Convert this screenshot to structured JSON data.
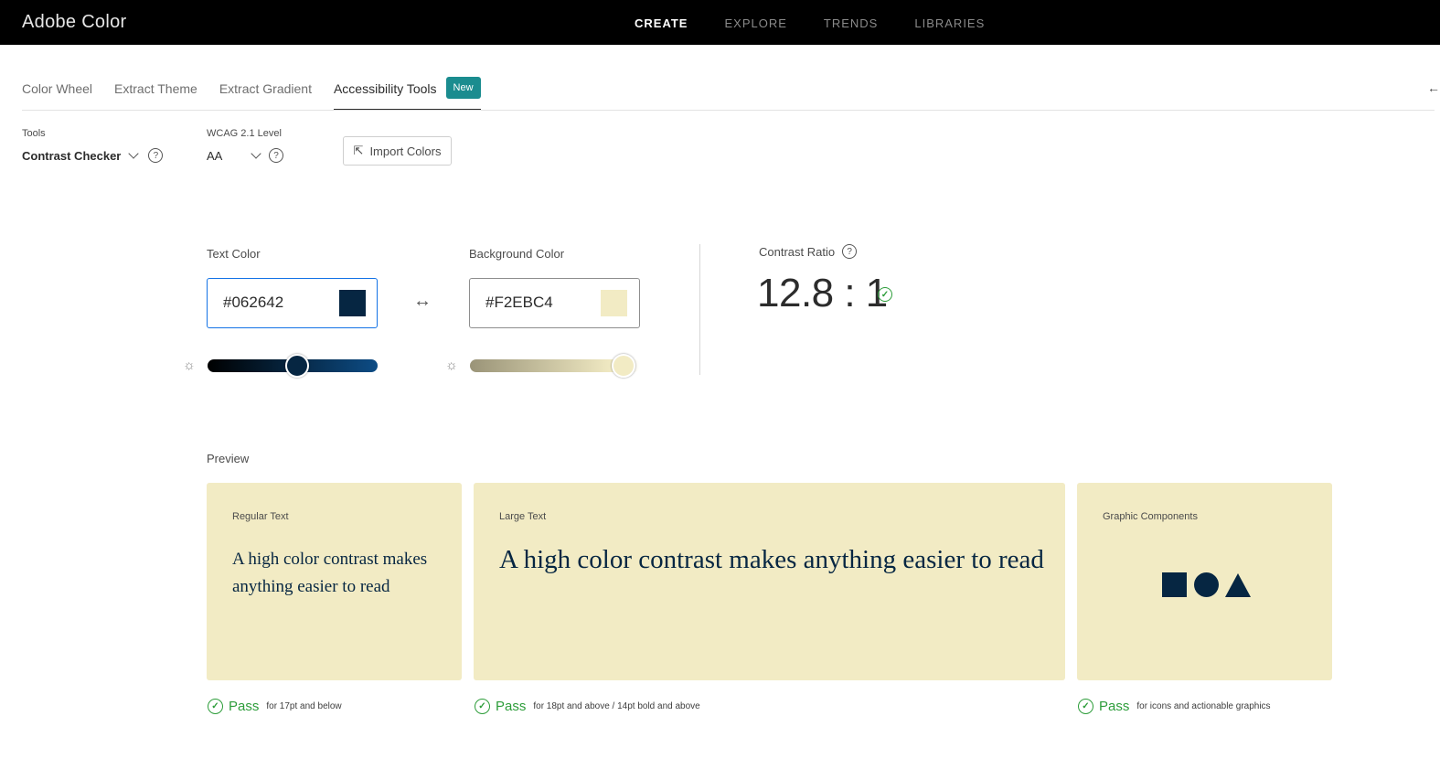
{
  "header": {
    "brand": "Adobe Color",
    "nav": [
      {
        "label": "CREATE",
        "active": true
      },
      {
        "label": "EXPLORE",
        "active": false
      },
      {
        "label": "TRENDS",
        "active": false
      },
      {
        "label": "LIBRARIES",
        "active": false
      }
    ]
  },
  "tabs": [
    {
      "label": "Color Wheel",
      "active": false
    },
    {
      "label": "Extract Theme",
      "active": false
    },
    {
      "label": "Extract Gradient",
      "active": false
    },
    {
      "label": "Accessibility Tools",
      "active": true,
      "badge": "New"
    }
  ],
  "controls": {
    "tools_label": "Tools",
    "tools_value": "Contrast Checker",
    "wcag_label": "WCAG 2.1 Level",
    "wcag_value": "AA",
    "import_label": "Import Colors"
  },
  "text_color": {
    "label": "Text Color",
    "hex": "#062642",
    "swatch": "#062642",
    "slider_level": 0.53
  },
  "background_color": {
    "label": "Background Color",
    "hex": "#F2EBC4",
    "swatch": "#F2EBC4",
    "slider_level": 0.92
  },
  "contrast": {
    "label": "Contrast Ratio",
    "value": "12.8 : 1"
  },
  "preview": {
    "label": "Preview",
    "regular_title": "Regular Text",
    "regular_sample": "A high color contrast makes anything easier to read",
    "large_title": "Large Text",
    "large_sample": "A high color contrast makes anything easier to read",
    "graphic_title": "Graphic Components"
  },
  "results": [
    {
      "status": "Pass",
      "note": "for 17pt and below"
    },
    {
      "status": "Pass",
      "note": "for 18pt and above / 14pt bold and above"
    },
    {
      "status": "Pass",
      "note": "for icons and actionable graphics"
    }
  ],
  "colors": {
    "accent": "#1a8c8f",
    "pass": "#2d9d3a",
    "text_color": "#062642",
    "background_color": "#f2ebc4"
  }
}
